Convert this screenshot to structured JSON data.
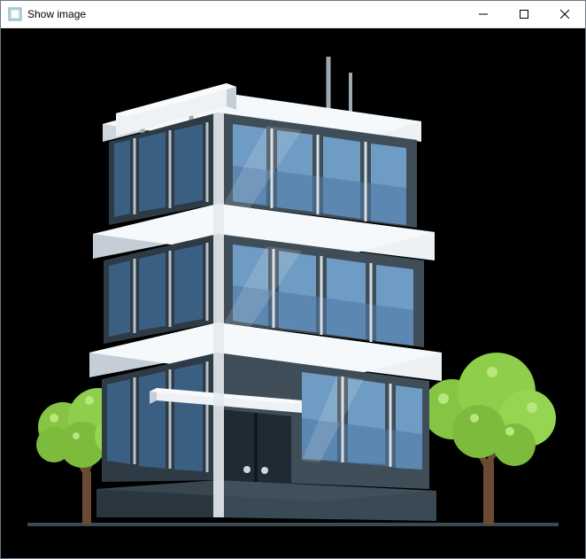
{
  "window": {
    "title": "Show image",
    "app_icon": "image-app-icon"
  },
  "image": {
    "description": "office-building-illustration"
  }
}
